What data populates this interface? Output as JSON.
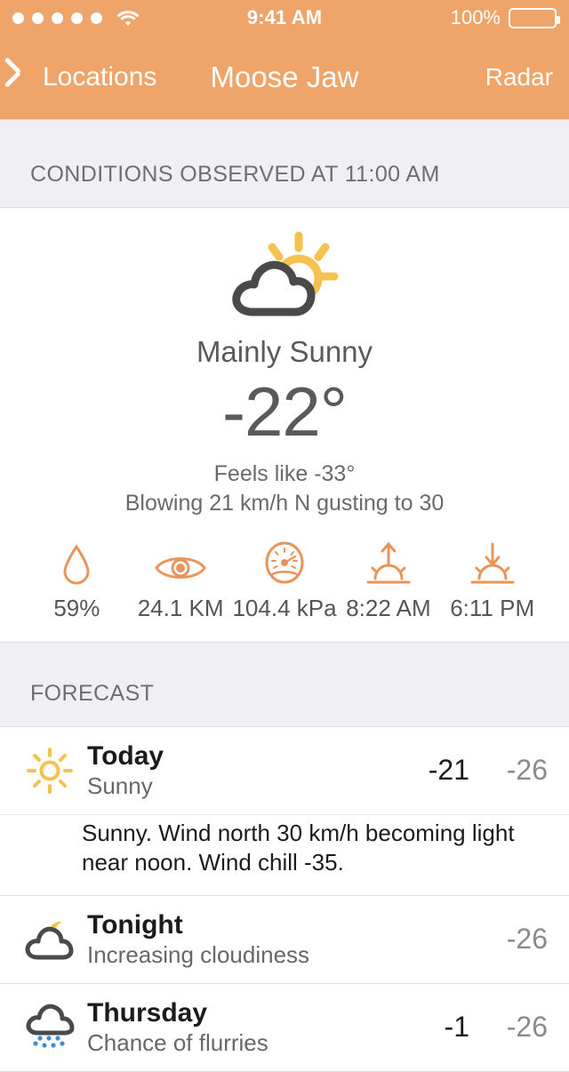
{
  "statusbar": {
    "signal_dots": 5,
    "wifi_icon": "wifi-icon",
    "time": "9:41 AM",
    "battery_percent": "100%",
    "battery_level": 100
  },
  "navbar": {
    "back_icon": "chevron-left-icon",
    "back_label": "Locations",
    "title": "Moose Jaw",
    "right_label": "Radar"
  },
  "conditions": {
    "header": "CONDITIONS OBSERVED AT 11:00 AM",
    "icon": "sun-behind-cloud-icon",
    "summary": "Mainly Sunny",
    "temperature": "-22°",
    "feels_like": "Feels like -33°",
    "wind": "Blowing 21 km/h N gusting to 30",
    "metrics": [
      {
        "icon": "humidity-droplet-icon",
        "value": "59%"
      },
      {
        "icon": "visibility-eye-icon",
        "value": "24.1 KM"
      },
      {
        "icon": "pressure-gauge-icon",
        "value": "104.4 kPa"
      },
      {
        "icon": "sunrise-icon",
        "value": "8:22 AM"
      },
      {
        "icon": "sunset-icon",
        "value": "6:11 PM"
      }
    ]
  },
  "forecast": {
    "header": "FORECAST",
    "rows": [
      {
        "icon": "sun-icon",
        "day": "Today",
        "description": "Sunny",
        "high": "-21",
        "low": "-26",
        "detail": "Sunny. Wind north 30 km/h becoming light near noon. Wind chill -35."
      },
      {
        "icon": "moon-behind-cloud-icon",
        "day": "Tonight",
        "description": "Increasing cloudiness",
        "high": "",
        "low": "-26",
        "detail": ""
      },
      {
        "icon": "cloud-flurries-icon",
        "day": "Thursday",
        "description": "Chance of flurries",
        "high": "-1",
        "low": "-26",
        "detail": ""
      }
    ]
  },
  "colors": {
    "accent_orange": "#EFA469",
    "icon_orange": "#E8945A",
    "sun_yellow": "#F5C14F",
    "cloud_gray": "#4A4A4A",
    "flurry_blue": "#3B8FD4",
    "section_bg": "#EFEFF4"
  }
}
